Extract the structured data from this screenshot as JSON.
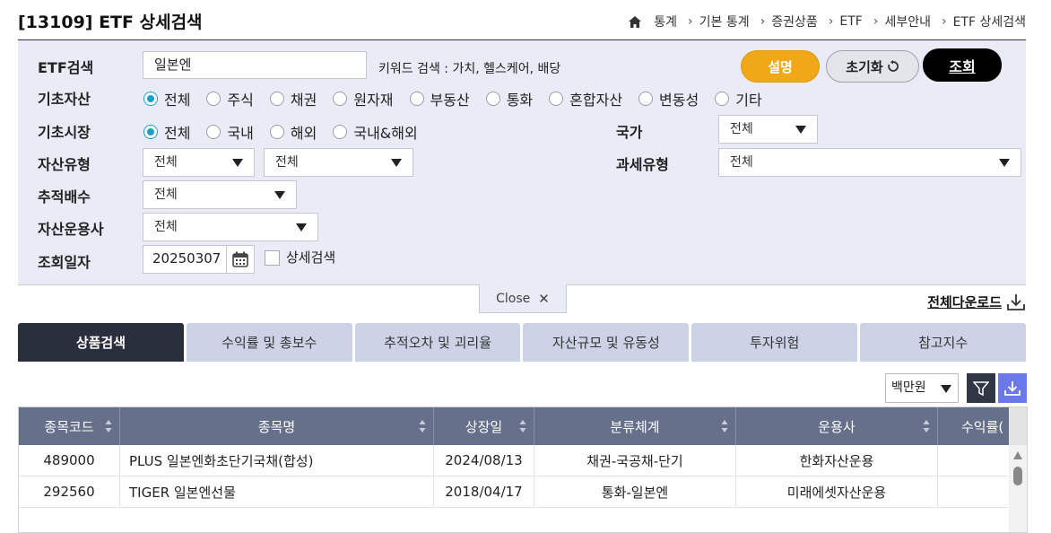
{
  "header": {
    "title": "[13109] ETF 상세검색",
    "breadcrumb": [
      "통계",
      "기본 통계",
      "증권상품",
      "ETF",
      "세부안내",
      "ETF 상세검색"
    ]
  },
  "form": {
    "etf_search": {
      "label": "ETF검색",
      "value": "일본엔",
      "hint": "키워드 검색 : 가치, 헬스케어, 배당"
    },
    "buttons": {
      "explain": "설명",
      "reset": "초기화",
      "search": "조회"
    },
    "underlying_asset": {
      "label": "기초자산",
      "options": [
        "전체",
        "주식",
        "채권",
        "원자재",
        "부동산",
        "통화",
        "혼합자산",
        "변동성",
        "기타"
      ],
      "selected": "전체"
    },
    "underlying_market": {
      "label": "기초시장",
      "options": [
        "전체",
        "국내",
        "해외",
        "국내&해외"
      ],
      "selected": "전체"
    },
    "country": {
      "label": "국가",
      "value": "전체"
    },
    "asset_type": {
      "label": "자산유형",
      "value1": "전체",
      "value2": "전체"
    },
    "tax_type": {
      "label": "과세유형",
      "value": "전체"
    },
    "tracking_multiple": {
      "label": "추적배수",
      "value": "전체"
    },
    "asset_manager": {
      "label": "자산운용사",
      "value": "전체"
    },
    "query_date": {
      "label": "조회일자",
      "value": "20250307"
    },
    "detail_search": {
      "label": "상세검색",
      "checked": false
    }
  },
  "close_label": "Close",
  "download_all": "전체다운로드",
  "tabs": [
    {
      "label": "상품검색",
      "active": true
    },
    {
      "label": "수익률 및 총보수",
      "active": false
    },
    {
      "label": "추적오차 및 괴리율",
      "active": false
    },
    {
      "label": "자산규모 및 유동성",
      "active": false
    },
    {
      "label": "투자위험",
      "active": false
    },
    {
      "label": "참고지수",
      "active": false
    }
  ],
  "unit": "백만원",
  "grid": {
    "columns": [
      "종목코드",
      "종목명",
      "상장일",
      "분류체계",
      "운용사",
      "수익률("
    ],
    "rows": [
      [
        "489000",
        "PLUS 일본엔화초단기국채(합성)",
        "2024/08/13",
        "채권-국공채-단기",
        "한화자산운용",
        ""
      ],
      [
        "292560",
        "TIGER 일본엔선물",
        "2018/04/17",
        "통화-일본엔",
        "미래에셋자산운용",
        ""
      ]
    ]
  },
  "colors": {
    "accent_orange": "#f0a818",
    "dark": "#2a2f3e",
    "radio_on": "#1ba0c9",
    "grid_header": "#66708a"
  }
}
